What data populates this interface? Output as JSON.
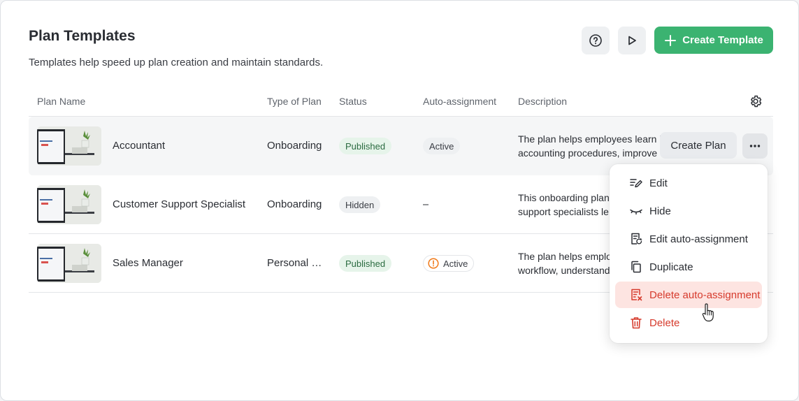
{
  "header": {
    "title": "Plan Templates",
    "subtitle": "Templates help speed up plan creation and maintain standards.",
    "create_button": "Create Template",
    "help_icon": "help-circle-icon",
    "play_icon": "play-icon"
  },
  "table": {
    "columns": [
      "Plan Name",
      "Type of Plan",
      "Status",
      "Auto-assignment",
      "Description"
    ],
    "settings_icon": "gear-icon",
    "rows": [
      {
        "name": "Accountant",
        "type": "Onboarding",
        "status": "Published",
        "auto_assignment": "Active",
        "description_line1": "The plan helps employees learn i",
        "description_line2": "accounting procedures, improve"
      },
      {
        "name": "Customer Support Specialist",
        "type": "Onboarding",
        "status": "Hidden",
        "auto_assignment": "–",
        "description_line1": "This onboarding plan",
        "description_line2": "support specialists le"
      },
      {
        "name": "Sales Manager",
        "type": "Personal development",
        "status": "Published",
        "auto_assignment": "Active",
        "description_line1": "The plan helps emplo",
        "description_line2": "workflow, understand"
      }
    ],
    "row_actions": {
      "create_plan": "Create Plan",
      "more_icon": "more-horizontal-icon"
    }
  },
  "context_menu": {
    "items": [
      {
        "label": "Edit",
        "icon": "edit-icon"
      },
      {
        "label": "Hide",
        "icon": "eye-closed-icon"
      },
      {
        "label": "Edit auto-assignment",
        "icon": "auto-assign-edit-icon"
      },
      {
        "label": "Duplicate",
        "icon": "copy-icon"
      },
      {
        "label": "Delete auto-assignment",
        "icon": "auto-assign-delete-icon"
      },
      {
        "label": "Delete",
        "icon": "trash-icon"
      }
    ]
  },
  "colors": {
    "primary": "#3bb371",
    "danger": "#d63a2c",
    "danger_highlight": "#fde4e1",
    "warning": "#f07a1a"
  }
}
